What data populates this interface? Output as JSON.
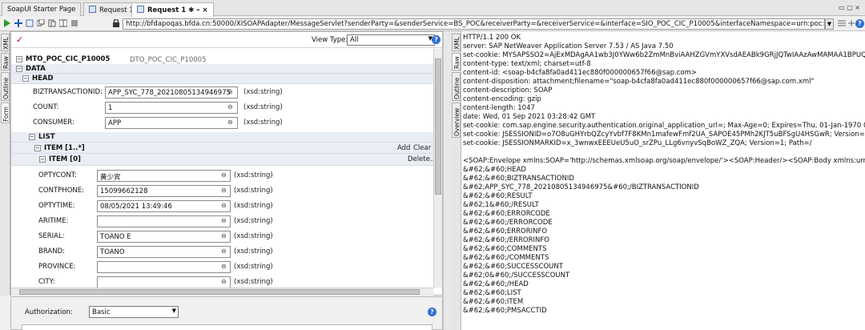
{
  "tabs": [
    {
      "label": "SoapUI Starter Page"
    },
    {
      "label": "Request 1"
    },
    {
      "label": "Request 1 ✱ – ×"
    }
  ],
  "window_controls": "▭ ▢ ×",
  "url": "http://bfdapoqas.bfda.cn:50000/XISOAPAdapter/MessageServlet?senderParty=&senderService=BS_POC&receiverParty=&receiverService=&interface=SIO_POC_CIC_P10005&interfaceNamespace=urn:poc:cic:out",
  "left": {
    "vtabs": [
      "XML",
      "Raw",
      "Outline",
      "Form"
    ],
    "view_type_label": "View Type:",
    "view_type_value": "All",
    "root_name": "MTO_POC_CIC_P10005",
    "root_type": "DTO_POC_CIC_P10005",
    "data_label": "DATA",
    "head_label": "HEAD",
    "head_fields": [
      {
        "label": "BIZTRANSACTIONID:",
        "value": "APP_SYC_778_20210805134946975",
        "type": "(xsd:string)"
      },
      {
        "label": "COUNT:",
        "value": "1",
        "type": "(xsd:string)"
      },
      {
        "label": "CONSUMER:",
        "value": "APP",
        "type": "(xsd:string)"
      }
    ],
    "list_label": "LIST",
    "item_group_label": "ITEM [1..*]",
    "add_label": "Add",
    "clear_label": "Clear",
    "item_label": "ITEM [0]",
    "delete_label": "Delete..",
    "item_fields": [
      {
        "label": "OPTYCONT:",
        "value": "黄少宾",
        "type": "(xsd:string)"
      },
      {
        "label": "CONTPHONE:",
        "value": "15099662128",
        "type": "(xsd:string)"
      },
      {
        "label": "OPTYTIME:",
        "value": "08/05/2021 13:49:46",
        "type": "(xsd:string)"
      },
      {
        "label": "ARITIME:",
        "value": "",
        "type": "(xsd:string)"
      },
      {
        "label": "SERIAL:",
        "value": "TOANO E",
        "type": "(xsd:string)"
      },
      {
        "label": "BRAND:",
        "value": "TOANO",
        "type": "(xsd:string)"
      },
      {
        "label": "PROVINCE:",
        "value": "",
        "type": "(xsd:string)"
      },
      {
        "label": "CITY:",
        "value": "",
        "type": "(xsd:string)"
      }
    ],
    "nil_symbol": "⊖"
  },
  "auth": {
    "label": "Authorization:",
    "value": "Basic"
  },
  "right": {
    "vtabs": [
      "XML",
      "Raw",
      "Outline",
      "Overview"
    ],
    "lines": [
      "HTTP/1.1 200 OK",
      "server: SAP NetWeaver Application Server 7.53 / AS Java 7.50",
      "set-cookie: MYSAPSSO2=AjExMDAgAA1wb3J0YWw6b2ZmMnBviAAHZGVmYXVsdAEABk9GRjJQTwIAAzAwMAMAA1BPUQQADD",
      "content-type: text/xml; charset=utf-8",
      "content-id: <soap-b4cfa8fa0ad411ec880f000000657f66@sap.com>",
      "content-disposition: attachment;filename=\"soap-b4cfa8fa0ad411ec880f000000657f66@sap.com.xml\"",
      "content-description: SOAP",
      "content-encoding: gzip",
      "content-length: 1047",
      "date: Wed, 01 Sep 2021 03:28:42 GMT",
      "set-cookie: com.sap.engine.security.authentication.original_application_url=; Max-Age=0; Expires=Thu, 01-Jan-1970 00:00:10 G",
      "set-cookie: JSESSIONID=o7O8uGHYrbQZcyYvbf7F8KMn1mafewFmf2UA_SAPOE45PMh2KJT5uBFSgU4HSGwR; Version=1; Path=",
      "set-cookie: JSESSIONMARKID=x_3wnwxEEEUeU5uO_srZPu_LLg6vnyvSqBoWZ_ZQA; Version=1; Path=/",
      "",
      "<SOAP:Envelope xmlns:SOAP='http://schemas.xmlsoap.org/soap/envelope/'><SOAP:Header/><SOAP:Body xmlns:urn='urn:po",
      "&#62;&#60;HEAD",
      "&#62;&#60;BIZTRANSACTIONID",
      "&#62;APP_SYC_778_20210805134946975&#60;/BIZTRANSACTIONID",
      "&#62;&#60;RESULT",
      "&#62;1&#60;/RESULT",
      "&#62;&#60;ERRORCODE",
      "&#62;&#60;/ERRORCODE",
      "&#62;&#60;ERRORINFO",
      "&#62;&#60;/ERRORINFO",
      "&#62;&#60;COMMENTS",
      "&#62;&#60;/COMMENTS",
      "&#62;&#60;SUCCESSCOUNT",
      "&#62;0&#60;/SUCCESSCOUNT",
      "&#62;&#60;/HEAD",
      "&#62;&#60;LIST",
      "&#62;&#60;ITEM",
      "&#62;&#60;PMSACCTID"
    ]
  }
}
